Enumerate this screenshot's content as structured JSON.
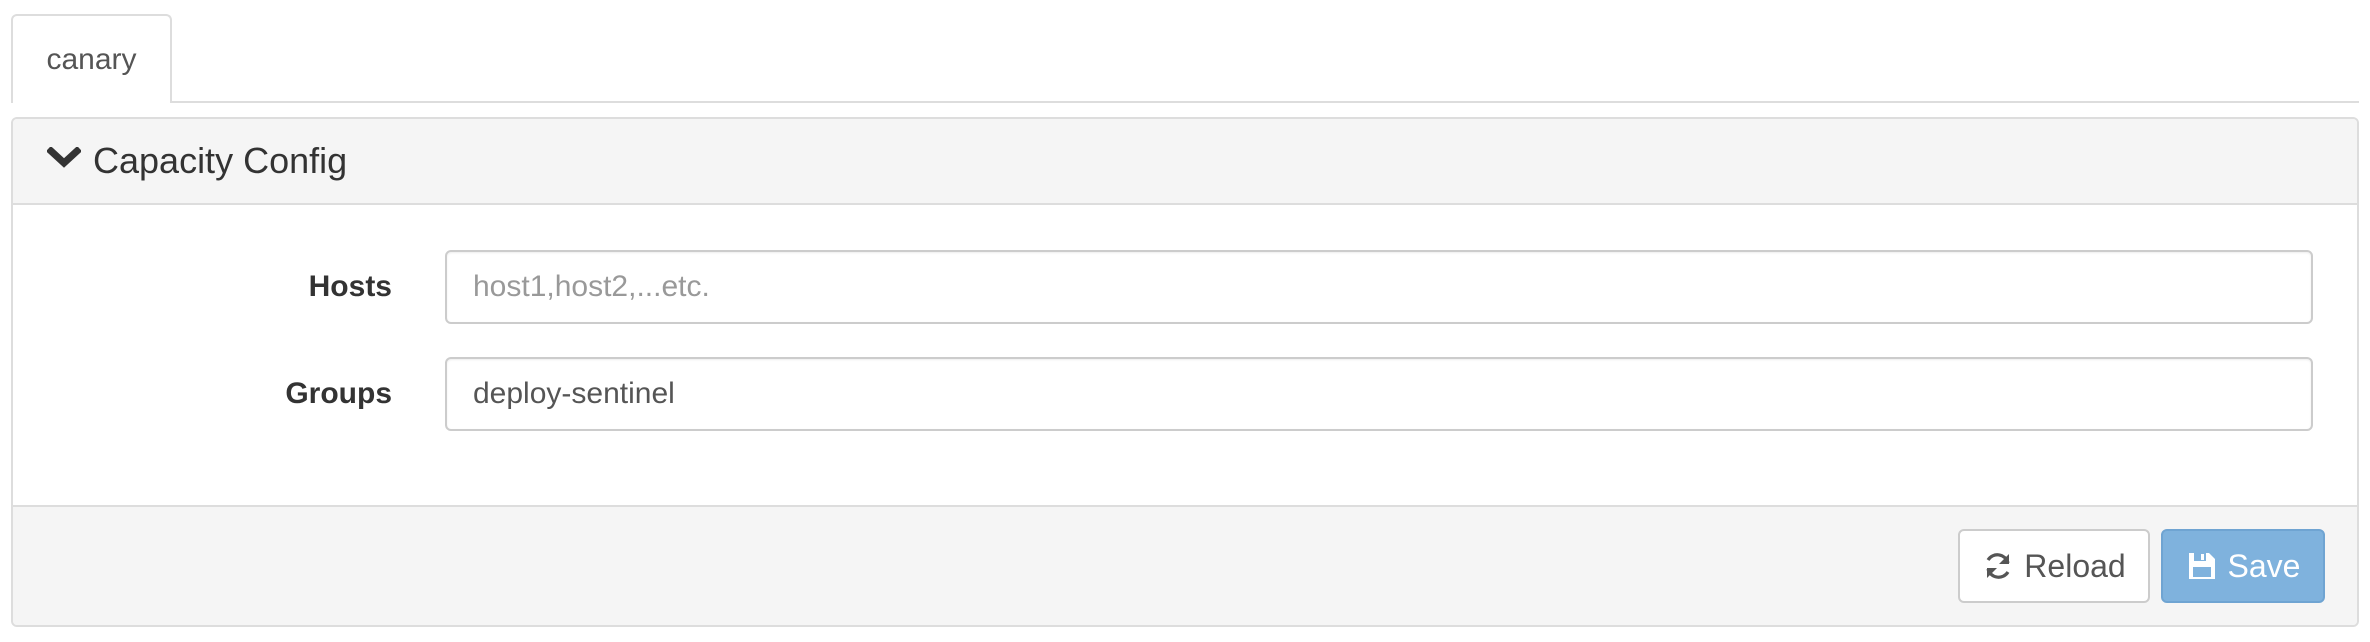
{
  "tabs": [
    {
      "label": "canary",
      "active": true
    }
  ],
  "panel": {
    "title": "Capacity Config",
    "toggle_icon": "chevron-down-icon"
  },
  "form": {
    "hosts": {
      "label": "Hosts",
      "value": "",
      "placeholder": "host1,host2,...etc."
    },
    "groups": {
      "label": "Groups",
      "value": "deploy-sentinel",
      "placeholder": ""
    }
  },
  "footer": {
    "reload_label": "Reload",
    "reload_icon": "refresh-icon",
    "save_label": "Save",
    "save_icon": "save-icon"
  },
  "colors": {
    "save_button_bg": "#7fb2dd",
    "panel_heading_bg": "#f5f5f5",
    "border": "#dddddd"
  }
}
